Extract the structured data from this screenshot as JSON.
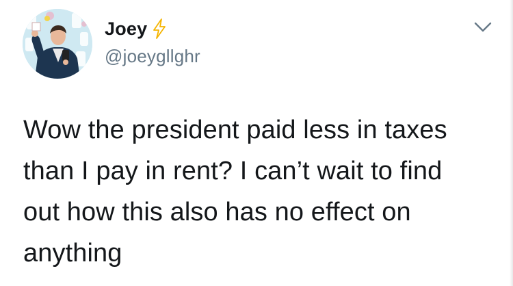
{
  "tweet": {
    "author": {
      "display_name": "Joey",
      "handle": "@joeygllghr",
      "name_emoji": "lightning-bolt-icon",
      "avatar": "avatar-photo"
    },
    "menu_icon": "chevron-down-icon",
    "text": "Wow the president paid less in taxes\nthan I pay in rent? I can’t wait to find\nout how this also has no effect on\nanything"
  },
  "colors": {
    "text": "#14171a",
    "secondary_text": "#657786",
    "bolt_outline": "#f5b400",
    "chevron": "#657786"
  }
}
